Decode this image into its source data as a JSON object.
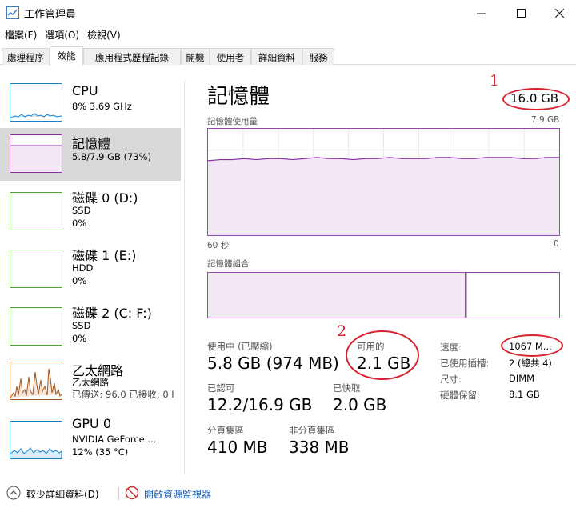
{
  "window": {
    "title": "工作管理員"
  },
  "menu": [
    "檔案(F)",
    "選項(O)",
    "檢視(V)"
  ],
  "tabs": [
    "處理程序",
    "效能",
    "應用程式歷程記錄",
    "開機",
    "使用者",
    "詳細資料",
    "服務"
  ],
  "sidebar": [
    {
      "name": "CPU",
      "sub1": "8% 3.69 GHz",
      "sub2": "",
      "sub3": "",
      "color": "#1880c8"
    },
    {
      "name": "記憶體",
      "sub1": "5.8/7.9 GB (73%)",
      "sub2": "",
      "sub3": "",
      "color": "#8b2fa8"
    },
    {
      "name": "磁碟 0 (D:)",
      "sub1": "SSD",
      "sub2": "0%",
      "sub3": "",
      "color": "#4da033"
    },
    {
      "name": "磁碟 1 (E:)",
      "sub1": "HDD",
      "sub2": "0%",
      "sub3": "",
      "color": "#4da033"
    },
    {
      "name": "磁碟 2 (C: F:)",
      "sub1": "SSD",
      "sub2": "0%",
      "sub3": "",
      "color": "#4da033"
    },
    {
      "name": "乙太網路",
      "sub1": "乙太網路",
      "sub2": "已傳送: 96.0 已接收: 0 I",
      "sub3": "",
      "color": "#a7541b"
    },
    {
      "name": "GPU 0",
      "sub1": "NVIDIA GeForce ...",
      "sub2": "12% (35 °C)",
      "sub3": "",
      "color": "#1880c8"
    }
  ],
  "main": {
    "title": "記憶體",
    "total": "16.0 GB",
    "usage_label": "記憶體使用量",
    "usage_max": "7.9 GB",
    "time_left": "60 秒",
    "time_right": "0",
    "composition_label": "記憶體組合"
  },
  "stats": {
    "in_use_label": "使用中 (已壓縮)",
    "in_use_value": "5.8 GB (974 MB)",
    "available_label": "可用的",
    "available_value": "2.1 GB",
    "committed_label": "已認可",
    "committed_value": "12.2/16.9 GB",
    "cached_label": "已快取",
    "cached_value": "2.0 GB",
    "paged_label": "分頁集區",
    "paged_value": "410 MB",
    "nonpaged_label": "非分頁集區",
    "nonpaged_value": "338 MB"
  },
  "details": [
    {
      "label": "速度:",
      "value": "1067 M..."
    },
    {
      "label": "已使用插槽:",
      "value": "2 (總共 4)"
    },
    {
      "label": "尺寸:",
      "value": "DIMM"
    },
    {
      "label": "硬體保留:",
      "value": "8.1 GB"
    }
  ],
  "annotations": {
    "one": "1",
    "two": "2"
  },
  "footer": {
    "fewer_details": "較少詳細資料(D)",
    "resource_monitor": "開啟資源監視器"
  },
  "colors": {
    "memory": "#8b2fa8",
    "accent_red": "#d8212d",
    "link": "#1a5fb4"
  },
  "usage_series_percent": [
    70,
    71,
    71,
    72,
    71,
    72,
    72,
    71,
    72,
    73,
    72,
    72,
    71,
    72,
    72,
    73,
    72,
    72,
    72,
    73,
    73,
    72,
    72,
    73,
    73,
    73,
    72,
    72,
    73,
    73
  ]
}
